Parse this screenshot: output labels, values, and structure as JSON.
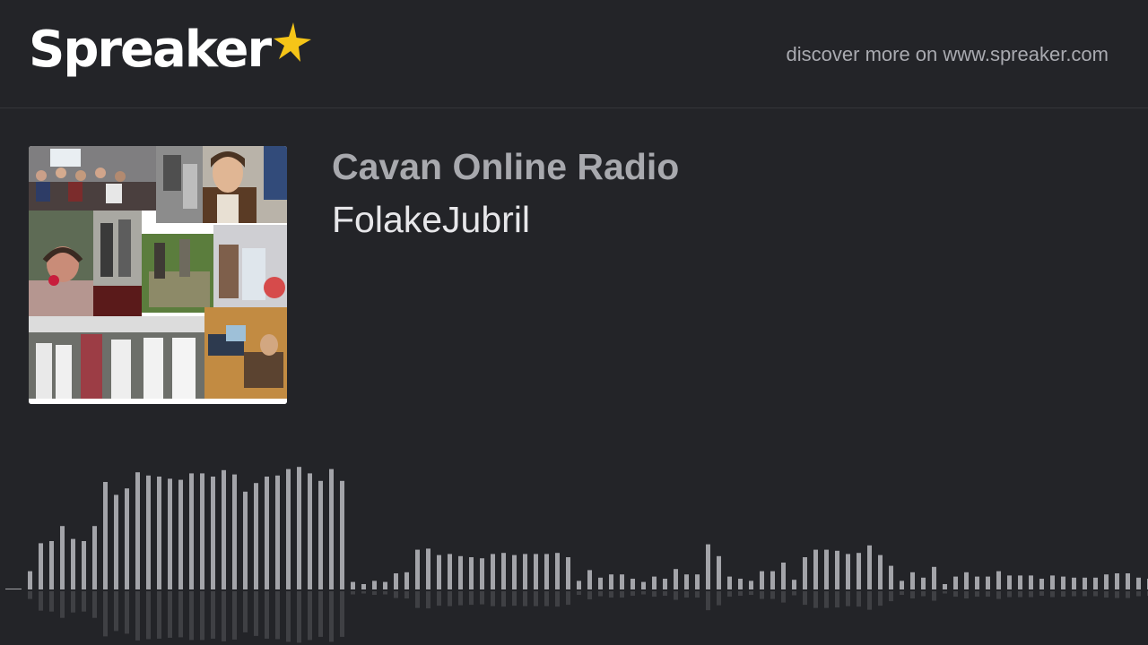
{
  "header": {
    "logo_text": "Spreaker",
    "logo_icon": "star-icon",
    "discover_text": "discover more on www.spreaker.com"
  },
  "episode": {
    "show_title": "Cavan Online Radio",
    "episode_title": "FolakeJubril",
    "cover_image": "photo-collage"
  },
  "colors": {
    "background": "#232428",
    "star": "#f5c518",
    "wave_bar": "#a3a4a9",
    "show_title": "#a8a9ae",
    "episode_title": "#e7e7ea"
  },
  "waveform": {
    "levels": [
      0.17,
      0.43,
      0.45,
      0.59,
      0.47,
      0.45,
      0.59,
      1.0,
      0.88,
      0.94,
      1.09,
      1.06,
      1.05,
      1.03,
      1.02,
      1.08,
      1.08,
      1.05,
      1.11,
      1.07,
      0.91,
      0.99,
      1.05,
      1.06,
      1.12,
      1.14,
      1.08,
      1.01,
      1.12,
      1.01,
      0.07,
      0.05,
      0.08,
      0.07,
      0.15,
      0.16,
      0.37,
      0.38,
      0.32,
      0.33,
      0.31,
      0.3,
      0.29,
      0.33,
      0.34,
      0.32,
      0.33,
      0.33,
      0.33,
      0.34,
      0.3,
      0.08,
      0.18,
      0.11,
      0.14,
      0.14,
      0.1,
      0.07,
      0.12,
      0.1,
      0.19,
      0.14,
      0.14,
      0.42,
      0.31,
      0.12,
      0.1,
      0.08,
      0.17,
      0.17,
      0.25,
      0.09,
      0.3,
      0.37,
      0.37,
      0.36,
      0.33,
      0.34,
      0.41,
      0.32,
      0.22,
      0.08,
      0.16,
      0.11,
      0.21,
      0.05,
      0.12,
      0.16,
      0.12,
      0.12,
      0.17,
      0.13,
      0.13,
      0.13,
      0.1,
      0.13,
      0.12,
      0.11,
      0.11,
      0.11,
      0.14,
      0.15,
      0.15,
      0.11,
      0.1
    ],
    "max_level": 1.25
  }
}
